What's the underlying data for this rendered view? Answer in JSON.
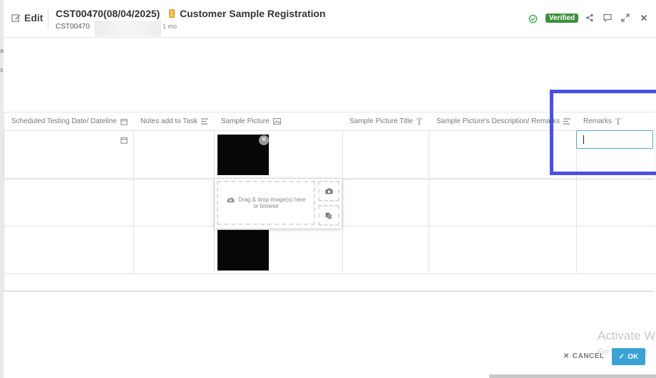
{
  "header": {
    "edit_label": "Edit",
    "record_title": "CST00470(08/04/2025)",
    "record_id": "CST00470",
    "record_time": "1 mo",
    "form_name": "Customer Sample Registration",
    "status_badge": "Verified"
  },
  "grid": {
    "columns": [
      {
        "label": "Scheduled Testing Date/ Dateline",
        "icon": "calendar-icon"
      },
      {
        "label": "Notes add to Task",
        "icon": "lines-icon"
      },
      {
        "label": "Sample Picture",
        "icon": "image-icon"
      },
      {
        "label": "Sample Picture Title",
        "icon": "text-icon"
      },
      {
        "label": "Sample Picture's Description/ Remarks",
        "icon": "lines-icon"
      },
      {
        "label": "Remarks",
        "icon": "text-icon"
      }
    ]
  },
  "upload": {
    "line1": "Drag & drop image(s) here",
    "line2": "or browse"
  },
  "footer": {
    "cancel_label": "CANCEL",
    "ok_label": "OK",
    "watermark_title": "Activate W",
    "watermark_sub": "Go to Setting"
  },
  "colors": {
    "accent": "#3aa3d4",
    "verified": "#3d8f3d",
    "highlight": "#4b50e4"
  }
}
